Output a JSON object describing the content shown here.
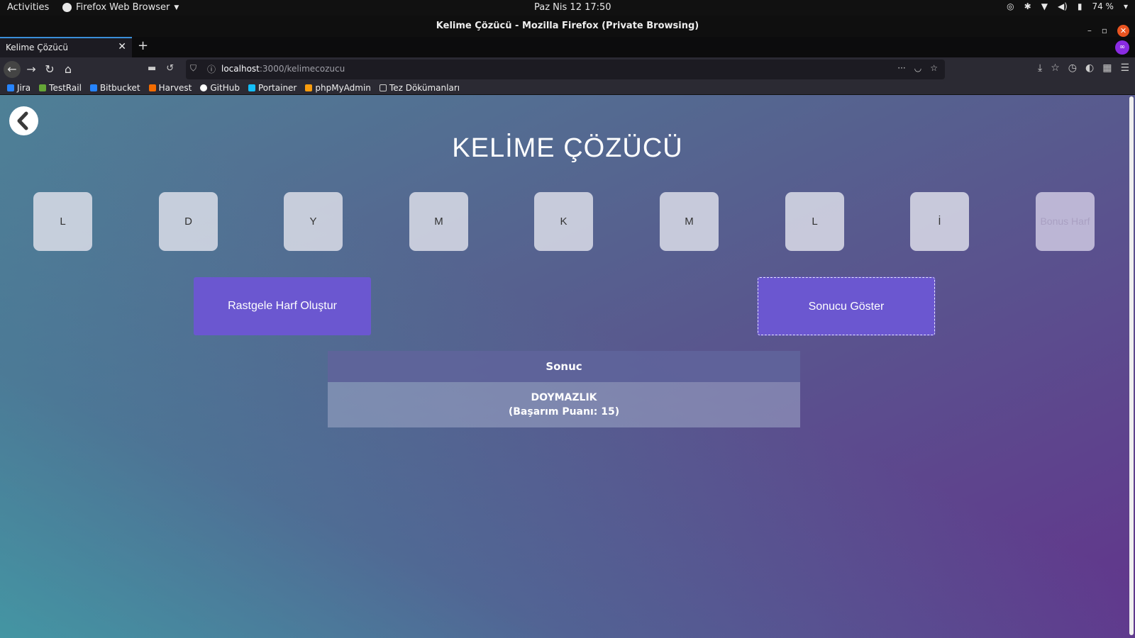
{
  "system": {
    "activities": "Activities",
    "app_menu": "Firefox Web Browser",
    "clock": "Paz Nis 12  17:50",
    "battery": "74 %"
  },
  "window": {
    "title": "Kelime Çözücü - Mozilla Firefox (Private Browsing)"
  },
  "tabs": [
    {
      "title": "Kelime Çözücü",
      "active": true
    }
  ],
  "urlbar": {
    "host": "localhost",
    "path": ":3000/kelimecozucu"
  },
  "bookmarks": [
    {
      "label": "Jira",
      "icon": "jira-icon",
      "color": "#2684ff"
    },
    {
      "label": "TestRail",
      "icon": "testrail-icon",
      "color": "#65a637"
    },
    {
      "label": "Bitbucket",
      "icon": "bitbucket-icon",
      "color": "#2684ff"
    },
    {
      "label": "Harvest",
      "icon": "harvest-icon",
      "color": "#f36c00"
    },
    {
      "label": "GitHub",
      "icon": "github-icon",
      "color": "#ffffff"
    },
    {
      "label": "Portainer",
      "icon": "portainer-icon",
      "color": "#13bef9"
    },
    {
      "label": "phpMyAdmin",
      "icon": "phpmyadmin-icon",
      "color": "#f89c0e"
    },
    {
      "label": "Tez Dökümanları",
      "icon": "folder-icon",
      "color": "#cccccc"
    }
  ],
  "page": {
    "title": "KELİME ÇÖZÜCÜ",
    "letters": [
      "L",
      "D",
      "Y",
      "M",
      "K",
      "M",
      "L",
      "İ"
    ],
    "bonus_placeholder": "Bonus Harf",
    "random_button": "Rastgele Harf Oluştur",
    "show_button": "Sonucu Göster",
    "result": {
      "header": "Sonuc",
      "word": "DOYMAZLIK",
      "score": "(Başarım Puanı: 15)"
    }
  },
  "colors": {
    "button": "#6b57d0",
    "accent_tab": "#3a8fd9"
  }
}
